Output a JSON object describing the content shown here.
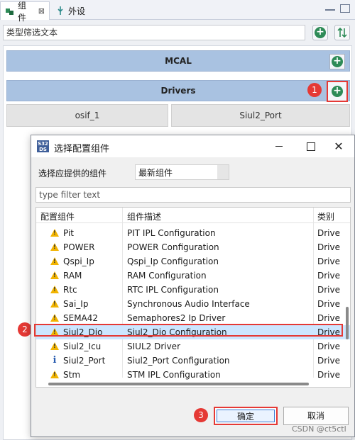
{
  "tabs": [
    {
      "label": "组件",
      "icon": "component-icon",
      "close": "⊠"
    },
    {
      "label": "外设",
      "icon": "usb-icon"
    }
  ],
  "view": {
    "filter_placeholder": "类型筛选文本",
    "add_icon": "plus-circle-icon",
    "sort_icon": "sort-icon"
  },
  "sections": {
    "mcal": "MCAL",
    "drivers": "Drivers"
  },
  "components": [
    "osif_1",
    "Siul2_Port"
  ],
  "badges": [
    "1",
    "2",
    "3"
  ],
  "dialog": {
    "title": "选择配置组件",
    "app_icon_text": "S32\nDS",
    "provider_label": "选择应提供的组件",
    "provider_value": "最新组件",
    "filter_placeholder": "type filter text",
    "columns": [
      "配置组件",
      "组件描述",
      "类别"
    ],
    "rows": [
      {
        "name": "Pit",
        "desc": "PIT IPL Configuration",
        "kind": "Drive",
        "icon": "warning-icon"
      },
      {
        "name": "POWER",
        "desc": "POWER Configuration",
        "kind": "Drive",
        "icon": "warning-icon"
      },
      {
        "name": "Qspi_Ip",
        "desc": "Qspi_Ip Configuration",
        "kind": "Drive",
        "icon": "warning-icon"
      },
      {
        "name": "RAM",
        "desc": "RAM Configuration",
        "kind": "Drive",
        "icon": "warning-icon"
      },
      {
        "name": "Rtc",
        "desc": "RTC IPL Configuration",
        "kind": "Drive",
        "icon": "warning-icon"
      },
      {
        "name": "Sai_Ip",
        "desc": "Synchronous Audio Interface",
        "kind": "Drive",
        "icon": "warning-icon"
      },
      {
        "name": "SEMA42",
        "desc": "Semaphores2 Ip Driver",
        "kind": "Drive",
        "icon": "warning-icon"
      },
      {
        "name": "Siul2_Dio",
        "desc": "Siul2_Dio Configuration",
        "kind": "Drive",
        "icon": "warning-icon",
        "selected": true
      },
      {
        "name": "Siul2_Icu",
        "desc": "SIUL2 Driver",
        "kind": "Drive",
        "icon": "warning-icon"
      },
      {
        "name": "Siul2_Port",
        "desc": "Siul2_Port Configuration",
        "kind": "Drive",
        "icon": "info-icon"
      },
      {
        "name": "Stm",
        "desc": "STM IPL Configuration",
        "kind": "Drive",
        "icon": "warning-icon"
      }
    ],
    "ok_label": "确定",
    "cancel_label": "取消"
  },
  "watermark": "CSDN @ct5ctl",
  "colors": {
    "section_bar": "#a9c2e1",
    "highlight": "#e53935",
    "selection": "#cce6ff",
    "plus": "#2e8b57"
  }
}
